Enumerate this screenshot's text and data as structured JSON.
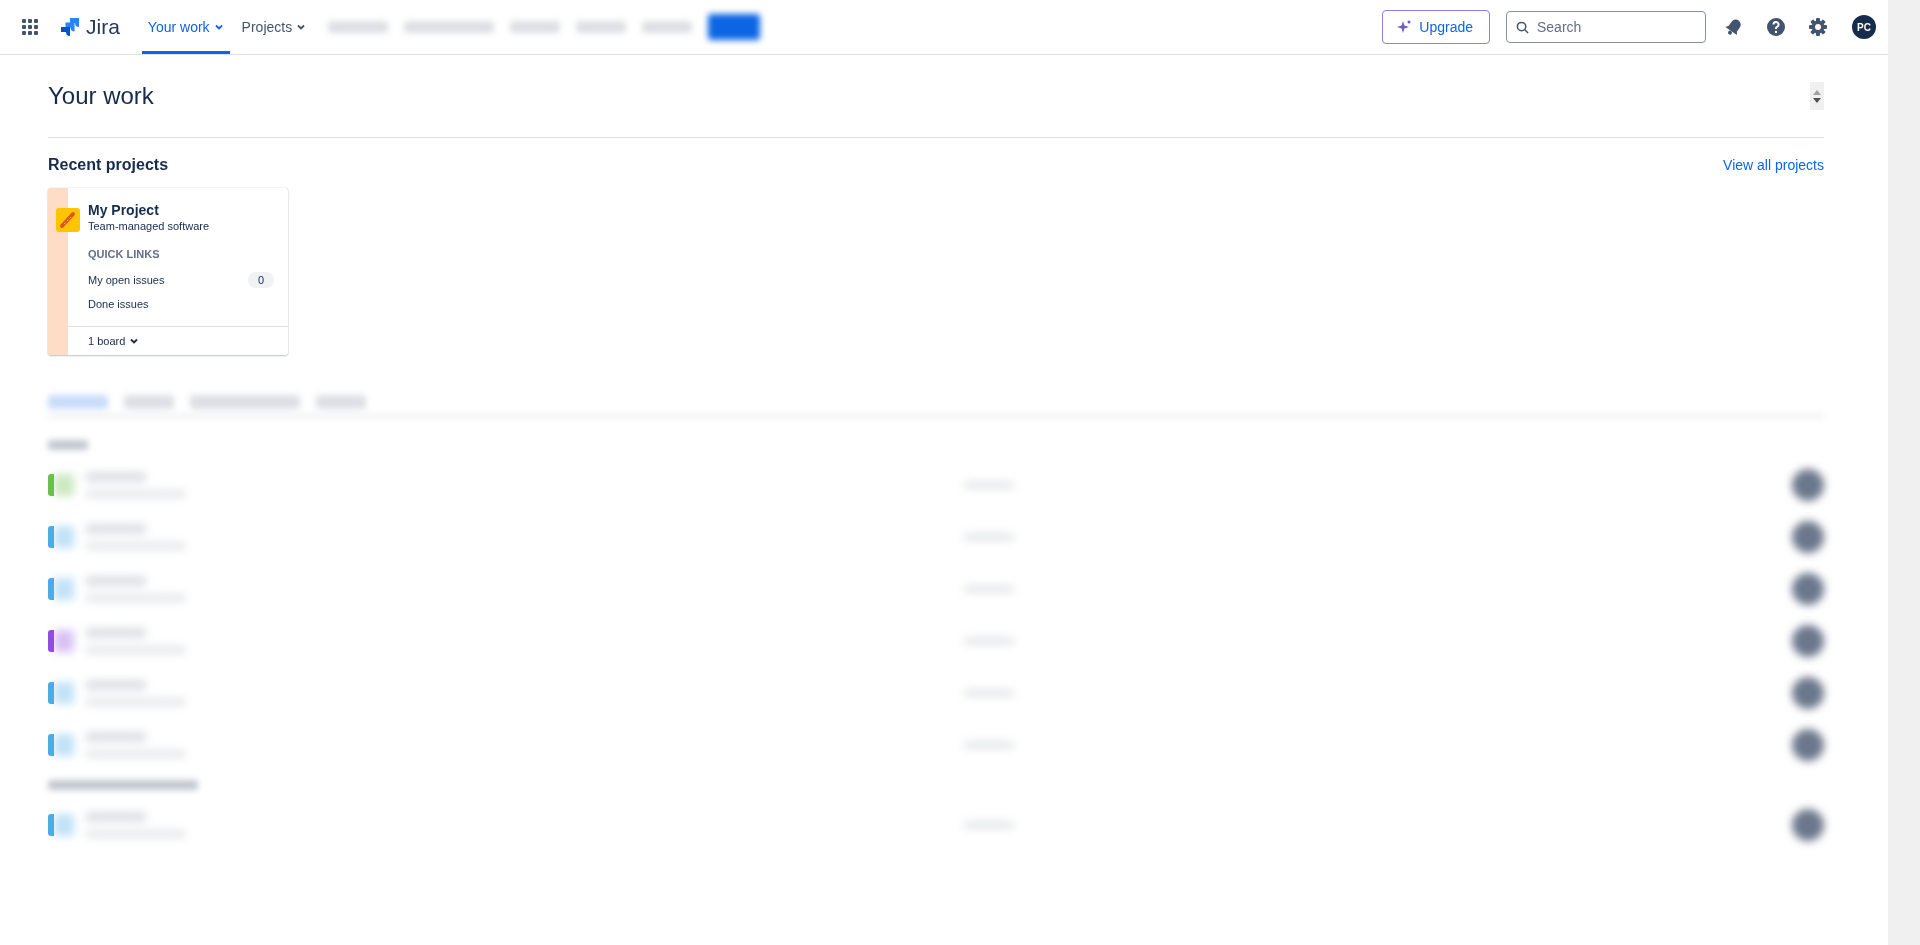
{
  "nav": {
    "app_name": "Jira",
    "items": [
      {
        "label": "Your work",
        "selected": true
      },
      {
        "label": "Projects",
        "selected": false
      }
    ]
  },
  "upgrade": "Upgrade",
  "search": {
    "placeholder": "Search"
  },
  "avatar": "PC",
  "page_title": "Your work",
  "recent": {
    "heading": "Recent projects",
    "link": "View all projects",
    "projects": [
      {
        "name": "My Project",
        "type": "Team-managed software",
        "quick_links_heading": "QUICK LINKS",
        "links": [
          {
            "label": "My open issues",
            "count": "0"
          },
          {
            "label": "Done issues"
          }
        ],
        "boards": "1 board"
      }
    ]
  },
  "work_sections": [
    {
      "rows": [
        {
          "color": "#6cc04a"
        },
        {
          "color": "#4bade8"
        },
        {
          "color": "#4bade8"
        },
        {
          "color": "#904ee2"
        },
        {
          "color": "#4bade8"
        },
        {
          "color": "#4bade8"
        }
      ]
    },
    {
      "rows": [
        {
          "color": "#4bade8"
        }
      ]
    }
  ]
}
